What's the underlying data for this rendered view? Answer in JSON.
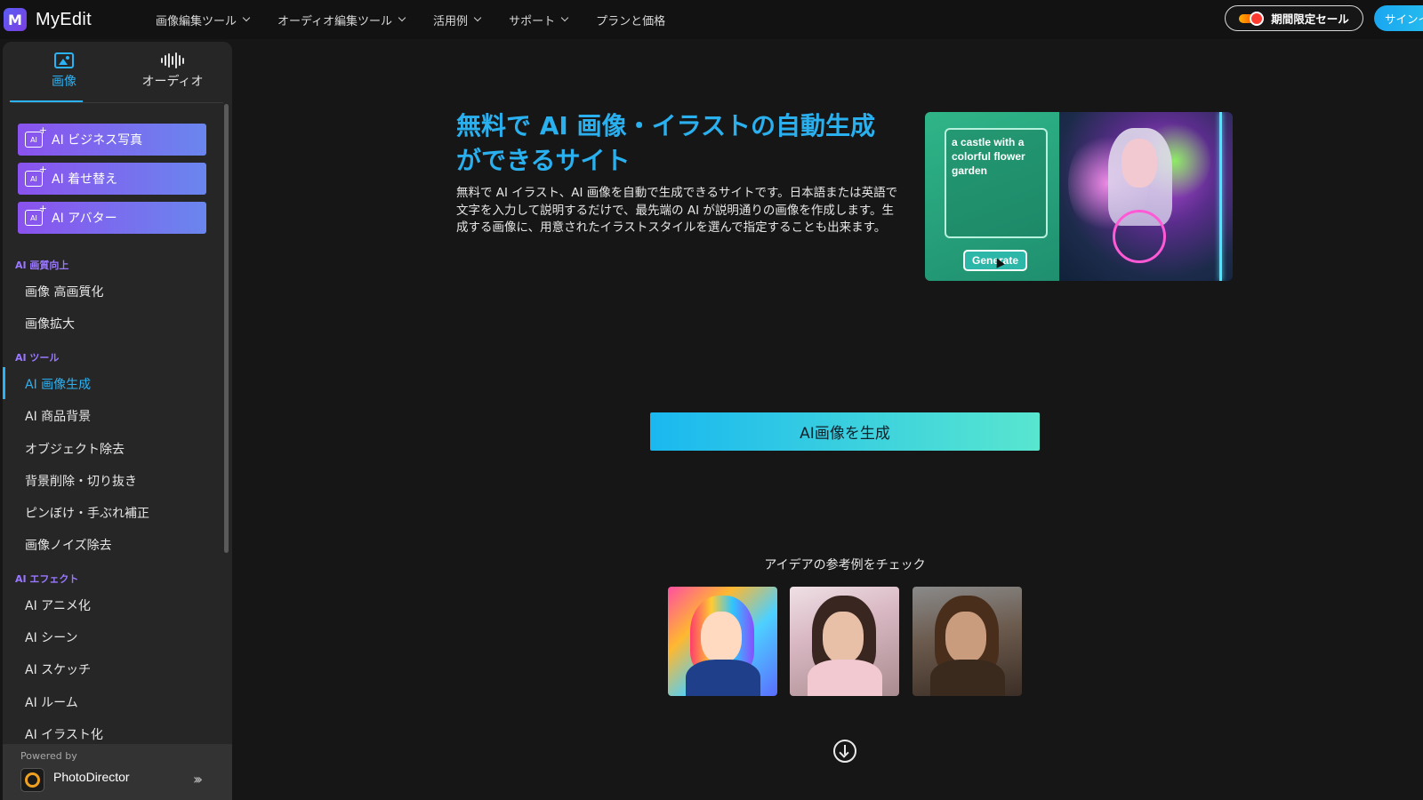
{
  "app": {
    "logo_letter": "M",
    "name": "MyEdit"
  },
  "nav": {
    "items": [
      {
        "label": "画像編集ツール",
        "dropdown": true
      },
      {
        "label": "オーディオ編集ツール",
        "dropdown": true
      },
      {
        "label": "活用例",
        "dropdown": true
      },
      {
        "label": "サポート",
        "dropdown": true
      },
      {
        "label": "プランと価格",
        "dropdown": false
      }
    ],
    "sale_label": "期間限定セール",
    "signin_label": "サインイ"
  },
  "sidebar": {
    "tabs": [
      {
        "label": "画像",
        "icon": "image-icon",
        "active": true
      },
      {
        "label": "オーディオ",
        "icon": "waveform-icon",
        "active": false
      }
    ],
    "feature_buttons": [
      {
        "label": "AI ビジネス写真",
        "icon": "ai-sparkle-icon"
      },
      {
        "label": "AI 着せ替え",
        "icon": "ai-sparkle-icon"
      },
      {
        "label": "AI アバター",
        "icon": "ai-sparkle-icon"
      }
    ],
    "sections": [
      {
        "heading": "AI 画質向上",
        "items": [
          "画像 高画質化",
          "画像拡大"
        ]
      },
      {
        "heading": "AI ツール",
        "items": [
          "AI 画像生成",
          "AI 商品背景",
          "オブジェクト除去",
          "背景削除・切り抜き",
          "ピンぼけ・手ぶれ補正",
          "画像ノイズ除去"
        ]
      },
      {
        "heading": "AI エフェクト",
        "items": [
          "AI アニメ化",
          "AI シーン",
          "AI スケッチ",
          "AI ルーム",
          "AI イラスト化"
        ]
      }
    ],
    "active_item": "AI 画像生成",
    "powered_by": "Powered by",
    "powered_product": "PhotoDirector"
  },
  "hero": {
    "title_line1": "無料で AI 画像・イラストの自動生成",
    "title_line2": "ができるサイト",
    "description": "無料で AI イラスト、AI 画像を自動で生成できるサイトです。日本語または英語で文字を入力して説明するだけで、最先端の AI が説明通りの画像を作成します。生成する画像に、用意されたイラストスタイルを選んで指定することも出来ます。",
    "demo_prompt": "a castle with a colorful flower garden",
    "demo_button": "Generate"
  },
  "main": {
    "generate_button": "AI画像を生成",
    "ideas_title": "アイデアの参考例をチェック"
  },
  "colors": {
    "accent": "#2bb2f5",
    "feature_gradient_start": "#8a52ee",
    "feature_gradient_end": "#6a86ee",
    "section_heading": "#9a78ff",
    "generate_gradient_start": "#1ab8f0",
    "generate_gradient_end": "#58e6cf"
  }
}
